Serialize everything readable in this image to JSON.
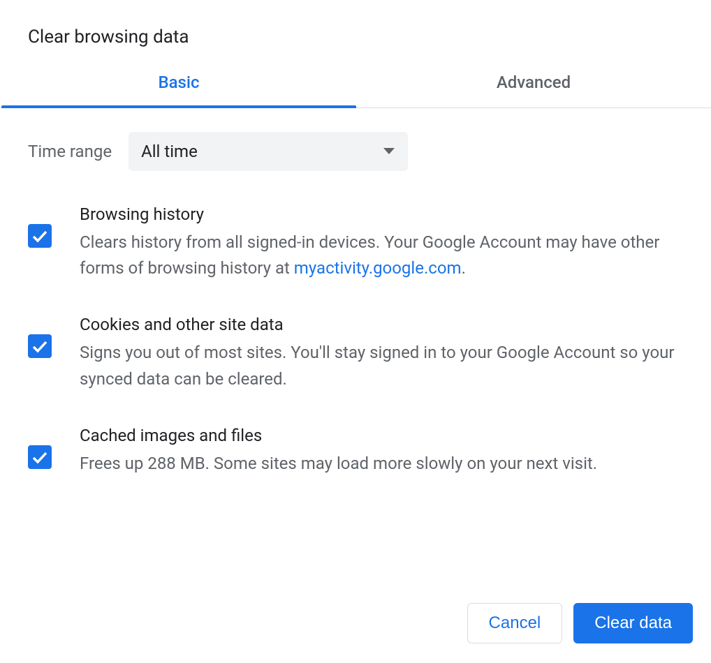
{
  "title": "Clear browsing data",
  "tabs": {
    "basic": "Basic",
    "advanced": "Advanced"
  },
  "time_range": {
    "label": "Time range",
    "value": "All time"
  },
  "options": {
    "browsing_history": {
      "title": "Browsing history",
      "desc_prefix": "Clears history from all signed-in devices. Your Google Account may have other forms of browsing history at ",
      "link": "myactivity.google.com",
      "desc_suffix": "."
    },
    "cookies": {
      "title": "Cookies and other site data",
      "desc": "Signs you out of most sites. You'll stay signed in to your Google Account so your synced data can be cleared."
    },
    "cache": {
      "title": "Cached images and files",
      "desc": "Frees up 288 MB. Some sites may load more slowly on your next visit."
    }
  },
  "buttons": {
    "cancel": "Cancel",
    "clear": "Clear data"
  }
}
